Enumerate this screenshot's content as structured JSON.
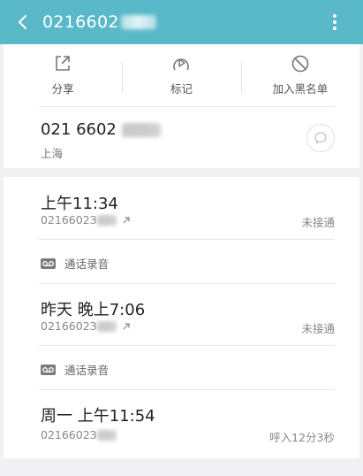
{
  "header": {
    "title": "0216602",
    "bg_color": "#5ab9c9",
    "back_icon": "back-arrow-icon",
    "more_icon": "more-vertical-icon"
  },
  "actions": [
    {
      "label": "分享",
      "icon": "share-icon"
    },
    {
      "label": "标记",
      "icon": "flag-icon"
    },
    {
      "label": "加入黑名单",
      "icon": "block-icon"
    }
  ],
  "contact": {
    "number": "021 6602",
    "location": "上海",
    "message_icon": "message-icon"
  },
  "call_log": [
    {
      "time": "上午11:34",
      "number": "0216602З",
      "status": "未接通",
      "outgoing": true
    },
    {
      "time": "昨天 晚上7:06",
      "number": "0216602З",
      "status": "未接通",
      "outgoing": true
    },
    {
      "time": "周一 上午11:54",
      "number": "0216602З",
      "status": "呼入12分3秒",
      "outgoing": false
    }
  ],
  "recording": {
    "label": "通话录音",
    "icon": "voicemail-icon"
  }
}
